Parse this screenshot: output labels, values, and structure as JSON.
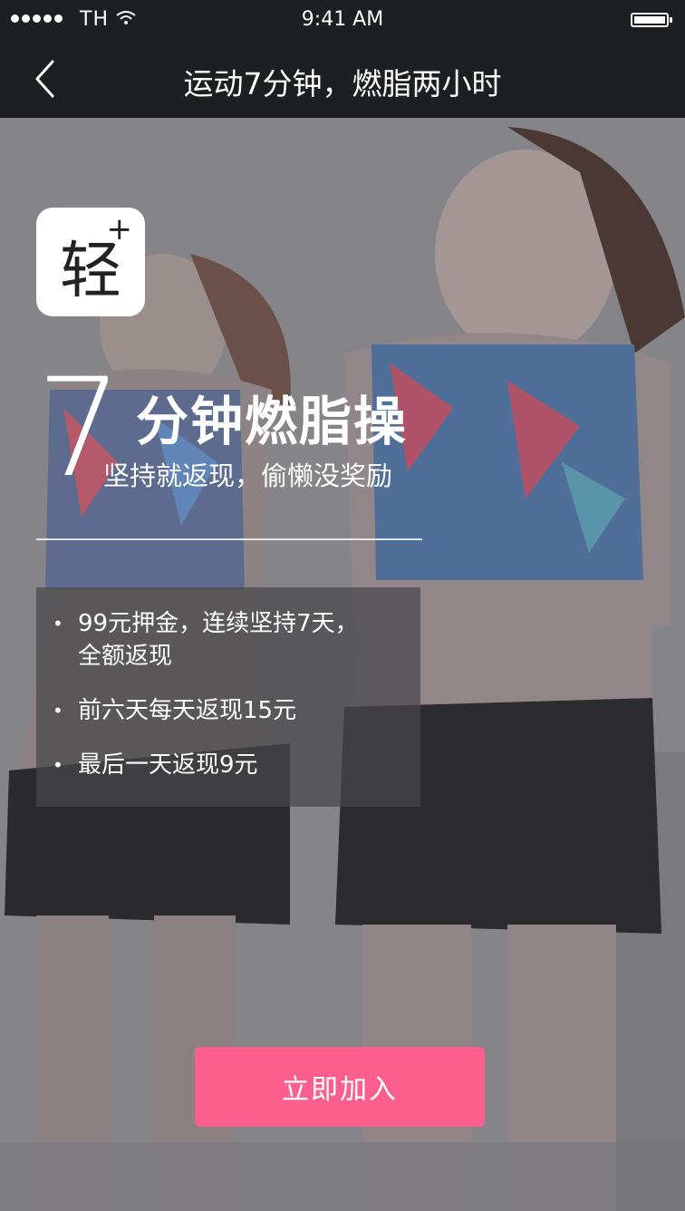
{
  "status_bar": {
    "carrier": "TH",
    "time": "9:41 AM"
  },
  "nav": {
    "title": "运动7分钟，燃脂两小时"
  },
  "hero": {
    "logo_text": "轻",
    "logo_superscript": "+",
    "big_number": "7",
    "headline": "分钟燃脂操",
    "subheadline": "坚持就返现，偷懒没奖励",
    "rules": [
      "99元押金，连续坚持7天，全额返现",
      "前六天每天返现15元",
      "最后一天返现9元"
    ]
  },
  "cta": {
    "label": "立即加入"
  },
  "colors": {
    "bar_background": "#1e1f22",
    "accent": "#fc5f8e"
  }
}
